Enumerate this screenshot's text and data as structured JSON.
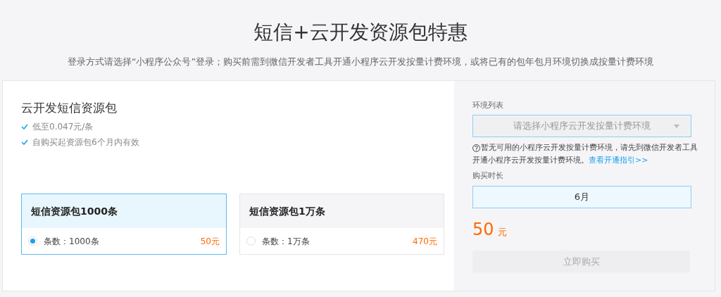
{
  "title": "短信+云开发资源包特惠",
  "subtitle": "登录方式请选择“小程序公众号”登录；购买前需到微信开发者工具开通小程序云开发按量计费环境，或将已有的包年包月环境切换成按量计费环境",
  "product": {
    "name": "云开发短信资源包",
    "features": [
      "低至0.047元/条",
      "自购买起资源包6个月内有效"
    ]
  },
  "packages": [
    {
      "name": "短信资源包1000条",
      "count": "条数：1000条",
      "price": "50元",
      "selected": true
    },
    {
      "name": "短信资源包1万条",
      "count": "条数：1万条",
      "price": "470元",
      "selected": false
    }
  ],
  "order": {
    "env_label": "环境列表",
    "env_placeholder": "请选择小程序云开发按量计费环境",
    "hint": "暂无可用的小程序云开发按量计费环境，请先到微信开发者工具开通小程序云开发按量计费环境。",
    "hint_link": "查看开通指引>>",
    "duration_label": "购买时长",
    "duration": "6月",
    "price": "50",
    "unit": "元",
    "buy_button": "立即购买",
    "buy_disabled": true
  }
}
